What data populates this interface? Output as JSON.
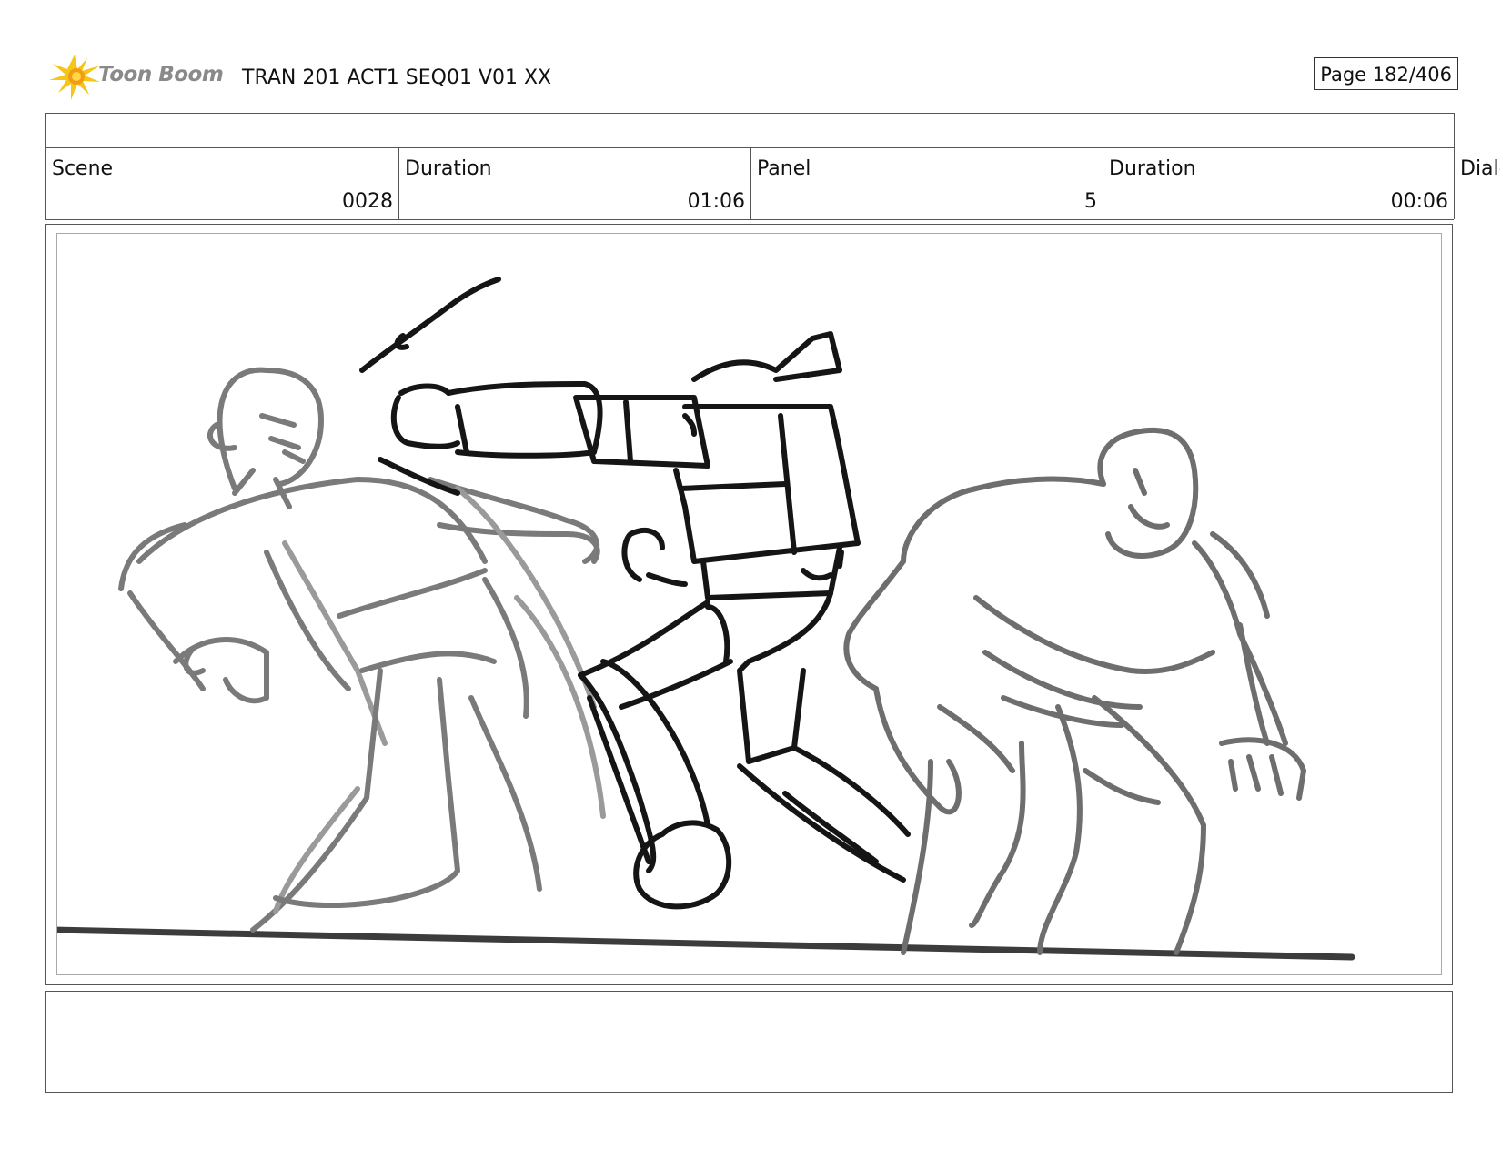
{
  "header": {
    "logo_text": "Toon Boom",
    "title": "TRAN 201 ACT1 SEQ01 V01 XX",
    "page_label": "Page 182/406"
  },
  "info": {
    "scene_label": "Scene",
    "scene_value": "0028",
    "scene_duration_label": "Duration",
    "scene_duration_value": "01:06",
    "panel_label": "Panel",
    "panel_value": "5",
    "panel_duration_label": "Duration",
    "panel_duration_value": "00:06",
    "dialog_label": "Dialo"
  },
  "colors": {
    "logo_yellow": "#f5c518",
    "logo_orange": "#f39c12",
    "sketch_black": "#151515",
    "sketch_gray": "#707070",
    "sketch_light_gray": "#8f8f8f"
  }
}
